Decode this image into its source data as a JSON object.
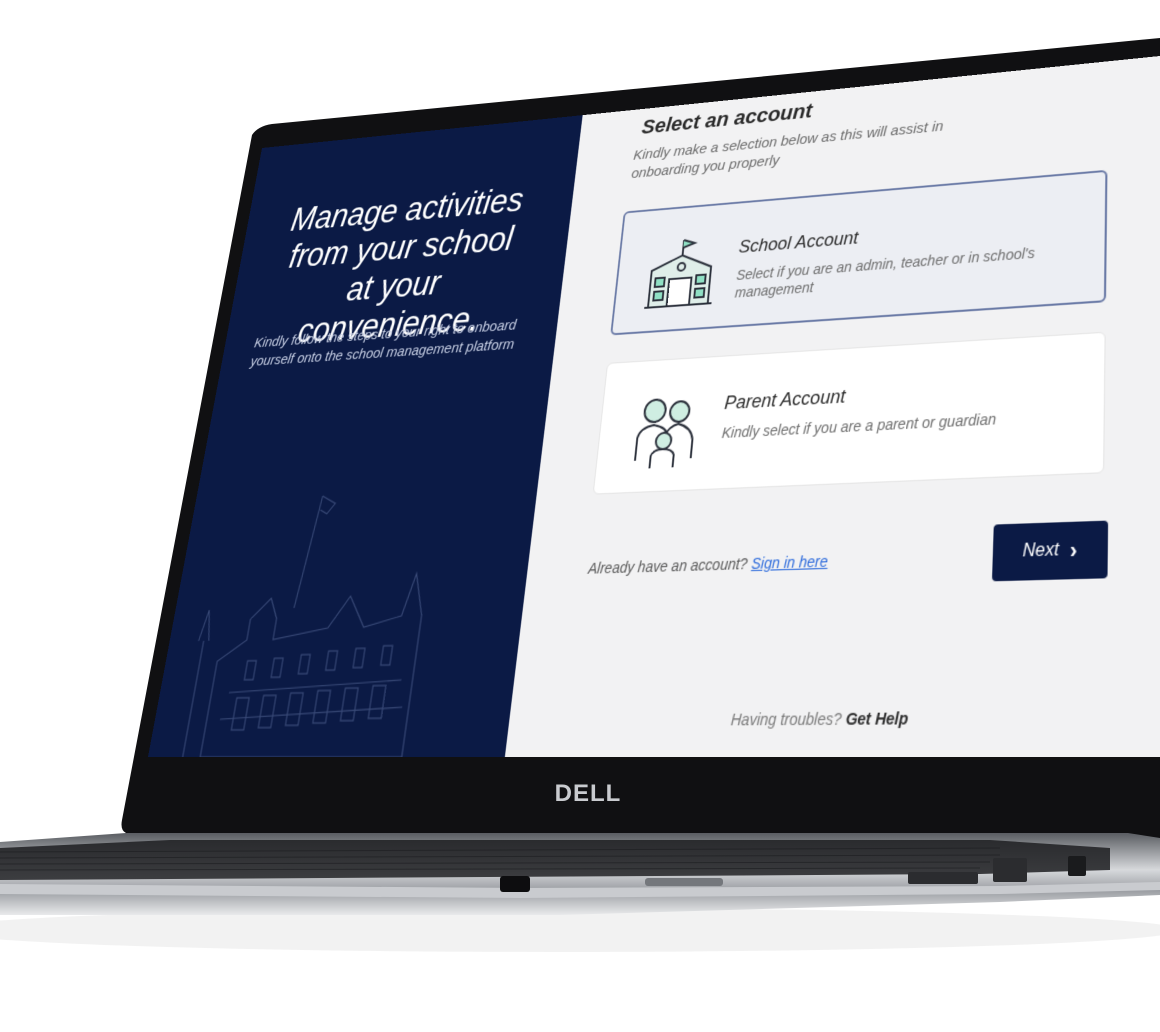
{
  "left": {
    "headline": "Manage activities from your school at your convenience.",
    "subtext": "Kindly follow the steps to your right to onboard yourself onto the school management platform"
  },
  "main": {
    "title": "Select an account",
    "subtitle": "Kindly make a selection below as this will assist in onboarding you properly",
    "accounts": [
      {
        "title": "School Account",
        "description": "Select if you are an admin, teacher or in school's management",
        "icon": "school-building-icon",
        "selected": true
      },
      {
        "title": "Parent Account",
        "description": "Kindly select if you are a parent or guardian",
        "icon": "family-icon",
        "selected": false
      }
    ],
    "signin_prompt": "Already have an account?",
    "signin_link": "Sign in here",
    "next_label": "Next",
    "help_prompt": "Having troubles?",
    "help_link": "Get Help"
  },
  "brand": {
    "laptop_logo": "DELL"
  },
  "colors": {
    "navy": "#0b1a45",
    "panel_bg": "#f2f2f3",
    "link": "#2d6bdc",
    "selected_border": "#6a7aa6"
  }
}
